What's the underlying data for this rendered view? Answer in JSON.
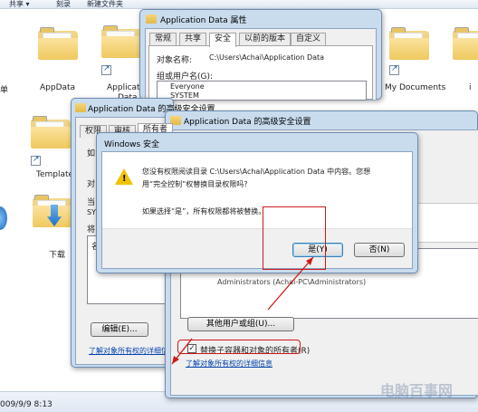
{
  "explorer": {
    "toolbar": {
      "share": "共享 ▾",
      "burn": "刻录",
      "new_folder": "新建文件夹"
    },
    "icons": {
      "dan_label": "单",
      "appdata": "AppData",
      "applicat": "Applicat",
      "data_fragment": "Data",
      "my_documents": "My Documents",
      "templates": "Template",
      "downloads": "下载",
      "right_edge_char": "i"
    },
    "status_date": "009/9/9 8:13"
  },
  "properties_window": {
    "title": "Application Data 属性",
    "tabs": [
      "常规",
      "共享",
      "安全",
      "以前的版本",
      "自定义"
    ],
    "active_tab": "安全",
    "object_name_label": "对象名称:",
    "object_name_value": "C:\\Users\\Achai\\Application Data",
    "group_label": "组或用户名(G):",
    "users": [
      "Everyone",
      "SYSTEM"
    ]
  },
  "advanced_window_back": {
    "title": "Application Data 的高级安全设置",
    "tabs": [
      "权限",
      "审核",
      "所有者"
    ],
    "active_tab": "所有者",
    "frag1": "如",
    "frag2": "对",
    "frag3": "当",
    "frag4": "SYS",
    "frag5": "将",
    "frag6": "名",
    "edit_button": "编辑(E)...",
    "learn_link": "了解对象所有权的详细信息"
  },
  "advanced_window_front": {
    "title": "Application Data 的高级安全设置",
    "list_fragment": "Administrators (Achai-PC\\Administrators)",
    "other_users_button": "其他用户或组(U)...",
    "replace_owner_checkbox": "替换子容器和对象的所有者(R)",
    "replace_owner_checked": true,
    "learn_link": "了解对象所有权的详细信息"
  },
  "security_dialog": {
    "title": "Windows 安全",
    "message_line1": "您没有权限阅读目录 C:\\Users\\Achai\\Application Data 中内容。您想",
    "message_line2": "用“完全控制”权替换目录权限吗?",
    "message_line3": "如果选择“是”，所有权限都将被替换。",
    "yes_button": "是(Y)",
    "no_button": "否(N)",
    "icon": "warning-icon"
  },
  "watermark": "电脑百事网",
  "colors": {
    "annotation_red": "#d01818",
    "title_bar": "#c9dcee",
    "link": "#0645ad"
  }
}
